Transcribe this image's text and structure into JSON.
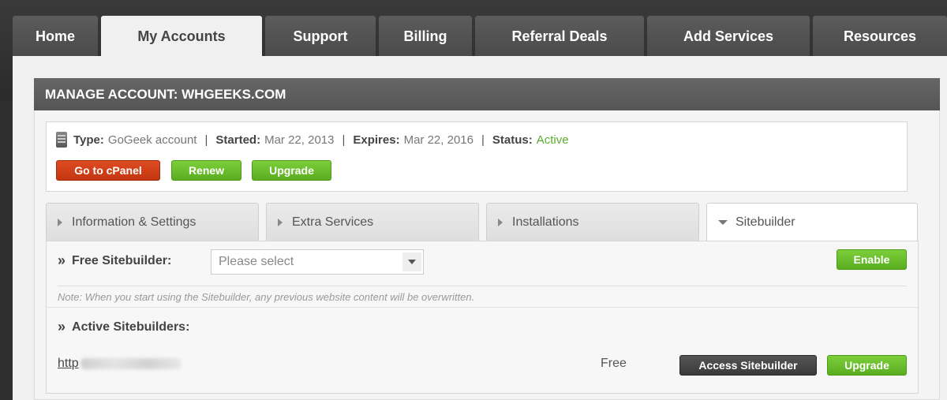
{
  "nav": {
    "tabs": [
      {
        "label": "Home"
      },
      {
        "label": "My Accounts"
      },
      {
        "label": "Support"
      },
      {
        "label": "Billing"
      },
      {
        "label": "Referral Deals"
      },
      {
        "label": "Add Services"
      },
      {
        "label": "Resources"
      }
    ],
    "active": "My Accounts"
  },
  "account": {
    "heading": "MANAGE ACCOUNT: WHGEEKS.COM",
    "type_label": "Type:",
    "type_value": "GoGeek account",
    "started_label": "Started:",
    "started_value": "Mar 22, 2013",
    "expires_label": "Expires:",
    "expires_value": "Mar 22, 2016",
    "status_label": "Status:",
    "status_value": "Active",
    "separator": "|",
    "icon": "server-icon"
  },
  "actions": {
    "cpanel": "Go to cPanel",
    "renew": "Renew",
    "upgrade": "Upgrade"
  },
  "subtabs": [
    {
      "label": "Information & Settings"
    },
    {
      "label": "Extra Services"
    },
    {
      "label": "Installations"
    },
    {
      "label": "Sitebuilder"
    }
  ],
  "sitebuilder": {
    "raquo": "»",
    "free_label": "Free Sitebuilder:",
    "select_placeholder": "Please select",
    "enable": "Enable",
    "note": "Note: When you start using the Sitebuilder, any previous website content will be overwritten.",
    "active_label": "Active Sitebuilders:",
    "url_prefix": "http",
    "plan": "Free",
    "access": "Access Sitebuilder",
    "upgrade": "Upgrade"
  },
  "colors": {
    "accent_green": "#5bad21",
    "accent_red": "#c2360f",
    "status_active": "#5aac2c",
    "header_bar": "#5a5a5a"
  }
}
